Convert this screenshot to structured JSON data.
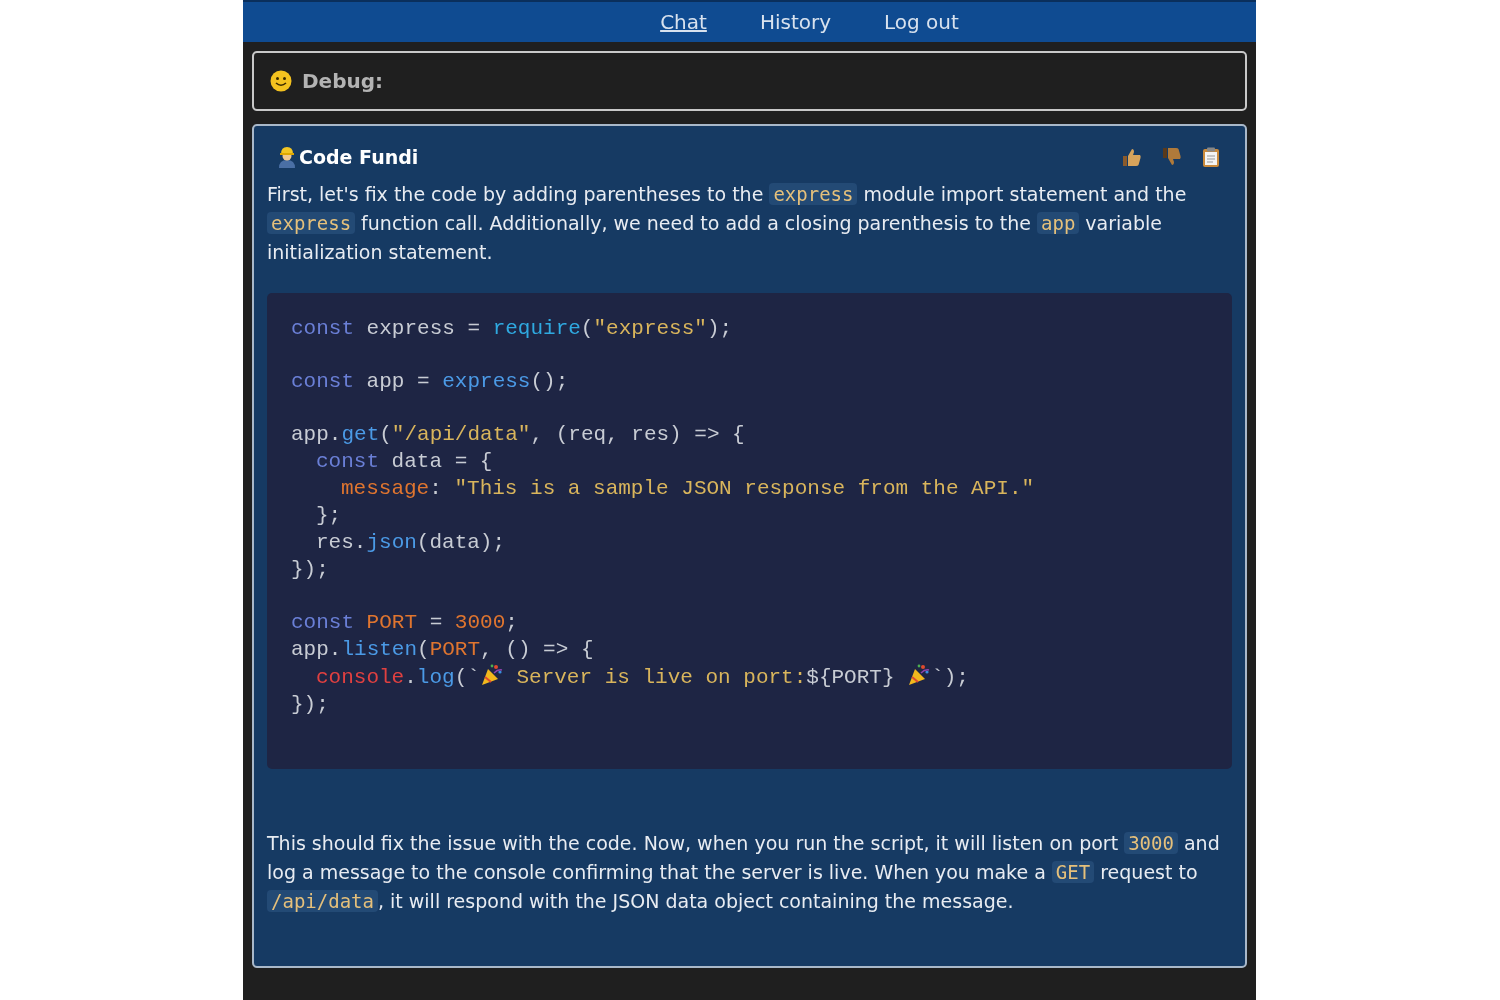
{
  "nav": {
    "links": [
      {
        "label": "Chat",
        "selected": true
      },
      {
        "label": "History",
        "selected": false
      },
      {
        "label": "Log out",
        "selected": false
      }
    ]
  },
  "debug": {
    "label": "Debug:"
  },
  "message": {
    "author": "Code Fundi",
    "intro": [
      {
        "kind": "text",
        "text": "First, let's fix the code by adding parentheses to the "
      },
      {
        "kind": "code",
        "text": "express"
      },
      {
        "kind": "text",
        "text": " module import statement and the "
      },
      {
        "kind": "code",
        "text": "express"
      },
      {
        "kind": "text",
        "text": " function call. Additionally, we need to add a closing parenthesis to the "
      },
      {
        "kind": "code",
        "text": "app"
      },
      {
        "kind": "text",
        "text": " variable initialization statement."
      }
    ],
    "code": [
      {
        "lines": [
          {
            "tokens": [
              {
                "kind": "kw",
                "text": "const"
              },
              {
                "kind": "plain",
                "text": " express = "
              },
              {
                "kind": "call",
                "text": "require"
              },
              {
                "kind": "plain",
                "text": "("
              },
              {
                "kind": "str",
                "text": "\"express\""
              },
              {
                "kind": "plain",
                "text": ");"
              }
            ]
          }
        ]
      },
      {
        "lines": [
          {
            "tokens": [
              {
                "kind": "kw",
                "text": "const"
              },
              {
                "kind": "plain",
                "text": " app = "
              },
              {
                "kind": "fn",
                "text": "express"
              },
              {
                "kind": "plain",
                "text": "();"
              }
            ]
          }
        ]
      },
      {
        "lines": [
          {
            "tokens": [
              {
                "kind": "plain",
                "text": "app."
              },
              {
                "kind": "fn",
                "text": "get"
              },
              {
                "kind": "plain",
                "text": "("
              },
              {
                "kind": "str",
                "text": "\"/api/data\""
              },
              {
                "kind": "plain",
                "text": ", (req, res) => {"
              }
            ],
            "children": [
              {
                "tokens": [
                  {
                    "kind": "kw",
                    "text": "const"
                  },
                  {
                    "kind": "plain",
                    "text": " data = {"
                  }
                ],
                "children": [
                  {
                    "tokens": [
                      {
                        "kind": "prop",
                        "text": "message"
                      },
                      {
                        "kind": "plain",
                        "text": ": "
                      },
                      {
                        "kind": "str",
                        "text": "\"This is a sample JSON response from the API.\""
                      }
                    ]
                  }
                ]
              },
              {
                "tokens": [
                  {
                    "kind": "plain",
                    "text": "};"
                  }
                ]
              },
              {
                "tokens": [
                  {
                    "kind": "plain",
                    "text": "res."
                  },
                  {
                    "kind": "fn",
                    "text": "json"
                  },
                  {
                    "kind": "plain",
                    "text": "(data);"
                  }
                ]
              }
            ]
          },
          {
            "tokens": [
              {
                "kind": "plain",
                "text": "});"
              }
            ]
          }
        ]
      },
      {
        "lines": [
          {
            "tokens": [
              {
                "kind": "kw",
                "text": "const"
              },
              {
                "kind": "prop",
                "text": " PORT"
              },
              {
                "kind": "plain",
                "text": " = "
              },
              {
                "kind": "num",
                "text": "3000"
              },
              {
                "kind": "plain",
                "text": ";"
              }
            ]
          },
          {
            "tokens": [
              {
                "kind": "plain",
                "text": "app."
              },
              {
                "kind": "fn",
                "text": "listen"
              },
              {
                "kind": "plain",
                "text": "("
              },
              {
                "kind": "prop",
                "text": "PORT"
              },
              {
                "kind": "plain",
                "text": ", () => {"
              }
            ],
            "children": [
              {
                "tokens": [
                  {
                    "kind": "obj",
                    "text": "console"
                  },
                  {
                    "kind": "plain",
                    "text": "."
                  },
                  {
                    "kind": "fn",
                    "text": "log"
                  },
                  {
                    "kind": "plain",
                    "text": "(`"
                  },
                  {
                    "kind": "party"
                  },
                  {
                    "kind": "str",
                    "text": " Server is live on port:"
                  },
                  {
                    "kind": "plain",
                    "text": "${PORT} "
                  },
                  {
                    "kind": "party"
                  },
                  {
                    "kind": "plain",
                    "text": "`);"
                  }
                ]
              }
            ]
          },
          {
            "tokens": [
              {
                "kind": "plain",
                "text": "});"
              }
            ]
          }
        ]
      }
    ],
    "outro": [
      {
        "kind": "text",
        "text": "This should fix the issue with the code. Now, when you run the script, it will listen on port "
      },
      {
        "kind": "code",
        "text": "3000"
      },
      {
        "kind": "text",
        "text": " and log a message to the console confirming that the server is live. When you make a "
      },
      {
        "kind": "code",
        "text": "GET"
      },
      {
        "kind": "text",
        "text": " request to "
      },
      {
        "kind": "code",
        "text": "/api/data"
      },
      {
        "kind": "text",
        "text": ", it will respond with the JSON data object containing the message."
      }
    ]
  }
}
